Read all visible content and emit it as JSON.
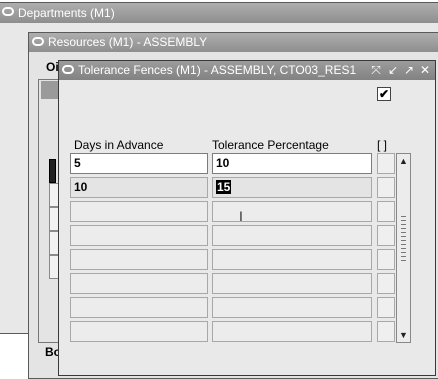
{
  "departments_window": {
    "title": "Departments (M1)"
  },
  "resources_window": {
    "title": "Resources (M1) - ASSEMBLY",
    "label_o": "Oi",
    "label_bo": "Bo"
  },
  "tolerance_window": {
    "title": "Tolerance Fences (M1) - ASSEMBLY, CTO03_RES1",
    "buttons": [
      "close-x",
      "minimize",
      "maximize",
      "close"
    ],
    "checkbox_checked": true,
    "columns": {
      "days_in_advance": "Days in Advance",
      "tolerance_percentage": "Tolerance Percentage",
      "flex": "[ ]"
    },
    "rows": [
      {
        "days": "5",
        "percent": "10"
      },
      {
        "days": "10",
        "percent": "15"
      },
      {
        "days": "",
        "percent": ""
      },
      {
        "days": "",
        "percent": ""
      },
      {
        "days": "",
        "percent": ""
      },
      {
        "days": "",
        "percent": ""
      },
      {
        "days": "",
        "percent": ""
      },
      {
        "days": "",
        "percent": ""
      }
    ]
  }
}
